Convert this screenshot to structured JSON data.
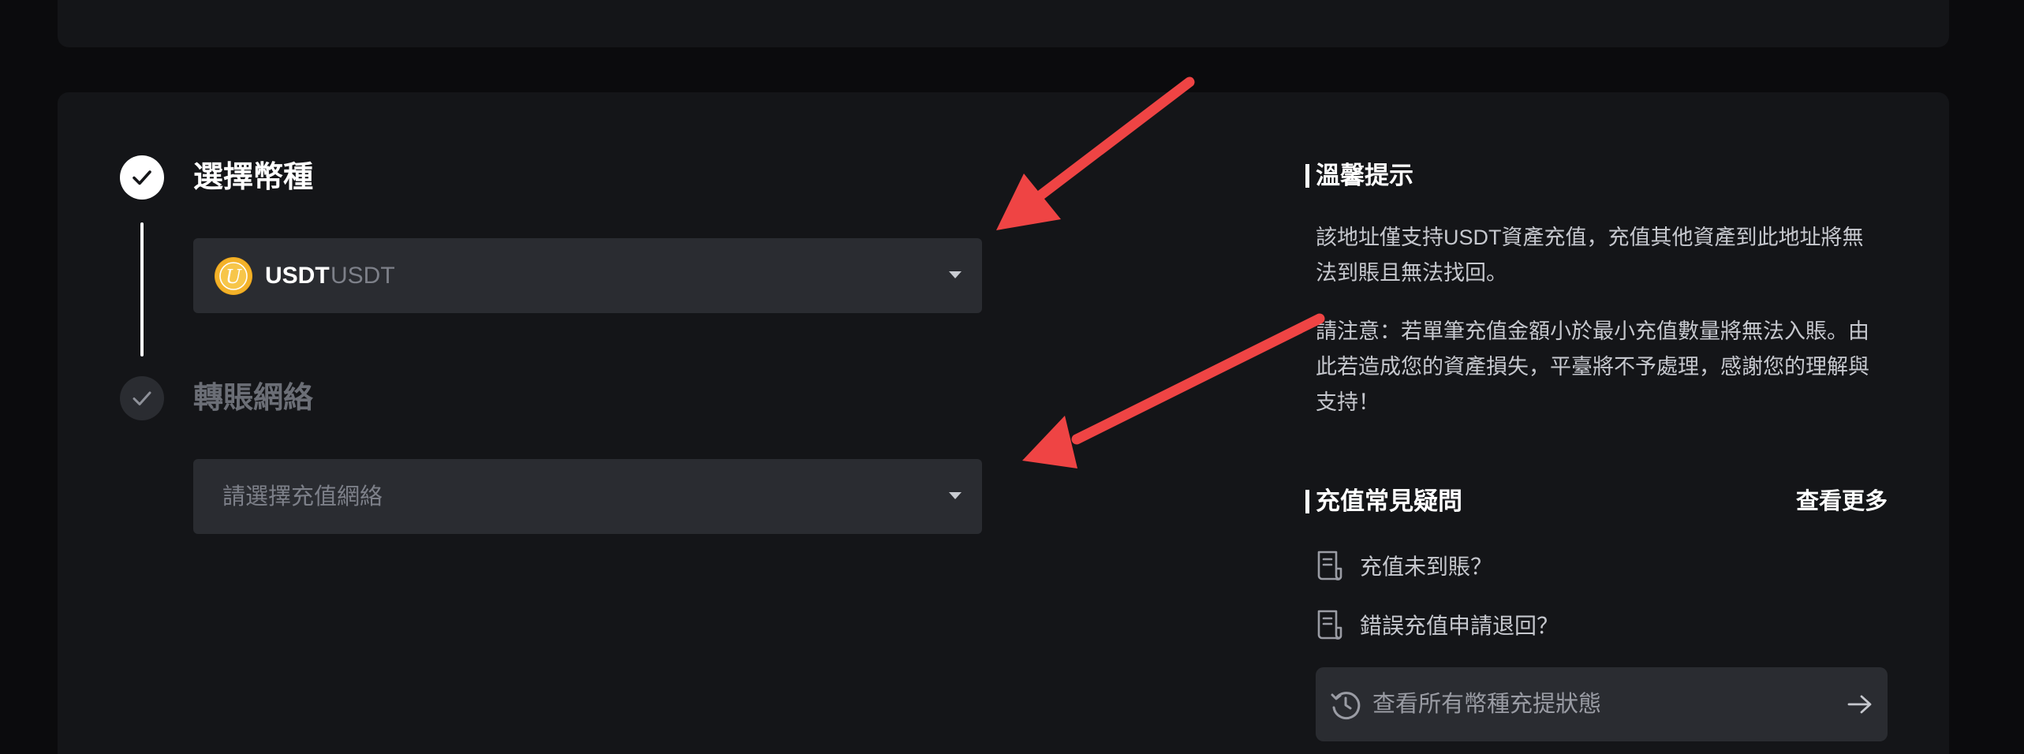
{
  "steps": [
    {
      "title": "選擇幣種",
      "state": "done"
    },
    {
      "title": "轉賬網絡",
      "state": "pending"
    }
  ],
  "coin_select": {
    "symbol": "USDT",
    "name": "USDT",
    "logo_letter": "U",
    "logo_color": "#f0a81a"
  },
  "network_select": {
    "placeholder": "請選擇充值網絡"
  },
  "tips": {
    "title": "溫馨提示",
    "paragraph1": "該地址僅支持USDT資產充值，充值其他資產到此地址將無法到賬且無法找回。",
    "paragraph2": "請注意：若單筆充值金額小於最小充值數量將無法入賬。由此若造成您的資產損失，平臺將不予處理，感謝您的理解與支持！"
  },
  "faq": {
    "title": "充值常見疑問",
    "more_label": "查看更多",
    "items": [
      {
        "label": "充值未到賬？",
        "icon": "document-icon"
      },
      {
        "label": "錯誤充值申請退回？",
        "icon": "document-icon"
      }
    ]
  },
  "status_button": {
    "label": "查看所有幣種充提狀態",
    "icon": "history-clock-icon",
    "trailing_icon": "arrow-right-icon"
  },
  "colors": {
    "background": "#0b0b0d",
    "card": "#141518",
    "input": "#2a2c31",
    "annotation_arrow": "#ef4444"
  }
}
